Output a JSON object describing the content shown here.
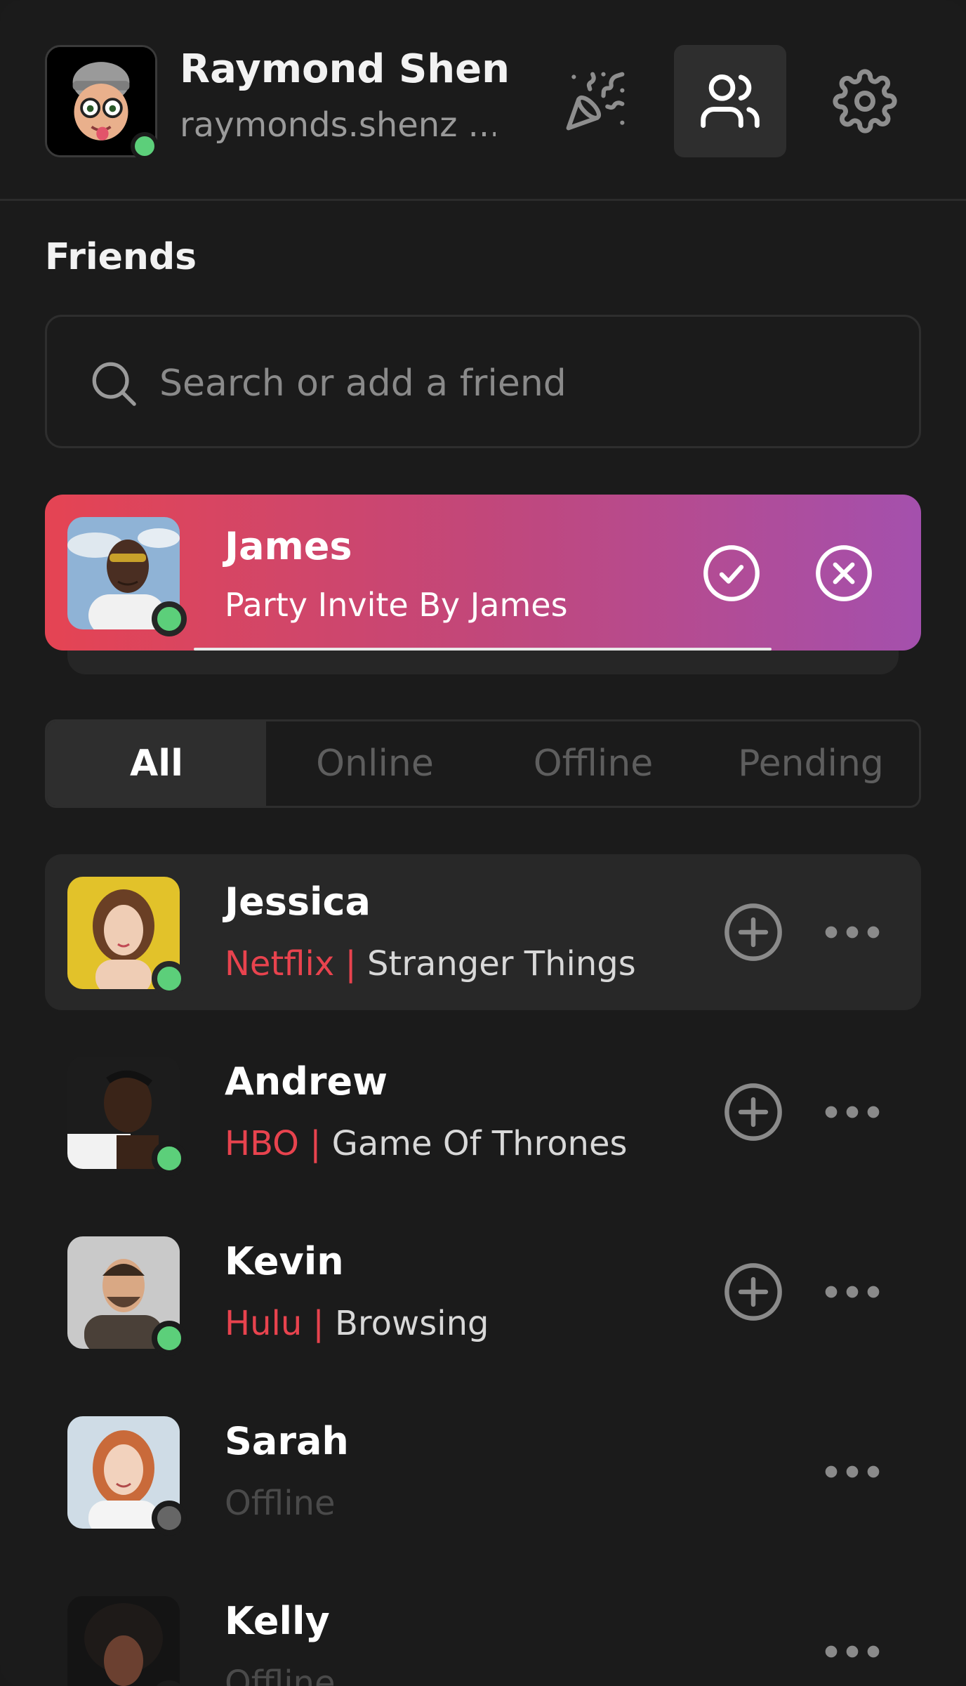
{
  "user": {
    "name": "Raymond Shen",
    "handle": "raymonds.shenz ...",
    "status": "online"
  },
  "header": {
    "party_icon": "party-popper-icon",
    "friends_icon": "users-icon",
    "settings_icon": "gear-icon"
  },
  "section": {
    "title": "Friends"
  },
  "search": {
    "placeholder": "Search or add a friend",
    "value": ""
  },
  "invite": {
    "name": "James",
    "message": "Party Invite By James",
    "status": "online",
    "progress": 0.73
  },
  "tabs": [
    {
      "label": "All",
      "active": true
    },
    {
      "label": "Online",
      "active": false
    },
    {
      "label": "Offline",
      "active": false
    },
    {
      "label": "Pending",
      "active": false
    }
  ],
  "friends": [
    {
      "name": "Jessica",
      "service": "Netflix",
      "separator": "|",
      "activity": "Stranger Things",
      "status": "online"
    },
    {
      "name": "Andrew",
      "service": "HBO",
      "separator": "|",
      "activity": "Game Of Thrones",
      "status": "online"
    },
    {
      "name": "Kevin",
      "service": "Hulu",
      "separator": "|",
      "activity": "Browsing",
      "status": "online"
    },
    {
      "name": "Sarah",
      "status_text": "Offline",
      "status": "offline"
    },
    {
      "name": "Kelly",
      "status_text": "Offline",
      "status": "offline"
    }
  ],
  "colors": {
    "background": "#1b1b1b",
    "online": "#5ccf7a",
    "offline": "#666666",
    "service": "#e8434e",
    "invite_gradient_start": "#e54453",
    "invite_gradient_end": "#a450ad"
  }
}
